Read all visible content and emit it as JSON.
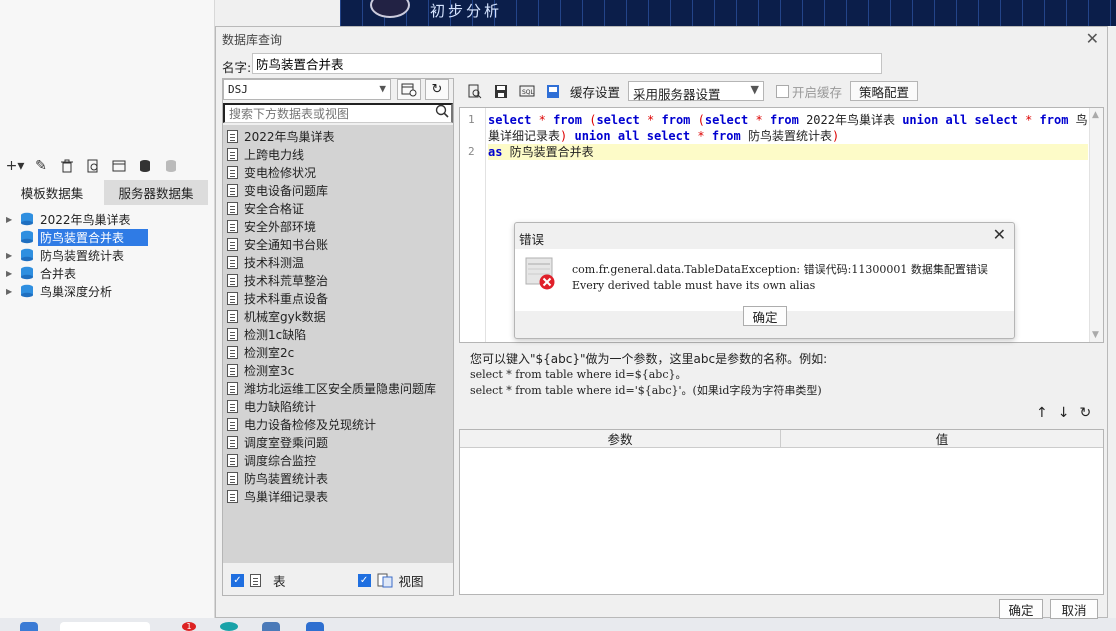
{
  "background": {
    "toolbar": {
      "add": "+▾",
      "edit": "✎",
      "delete": "🗑"
    },
    "tabs": [
      "模板数据集",
      "服务器数据集"
    ],
    "tree": [
      {
        "label": "2022年鸟巢详表",
        "selected": false
      },
      {
        "label": "防鸟装置合并表",
        "selected": true
      },
      {
        "label": "防鸟装置统计表",
        "selected": false
      },
      {
        "label": "合并表",
        "selected": false
      },
      {
        "label": "鸟巢深度分析",
        "selected": false
      }
    ],
    "top_title": "初步分析",
    "taskbar_badge": "1"
  },
  "dialog": {
    "title": "数据库查询",
    "name_label": "名字:",
    "name_value": "防鸟装置合并表",
    "connection": "DSJ",
    "search_placeholder": "搜索下方数据表或视图",
    "tables": [
      "2022年鸟巢详表",
      "上跨电力线",
      "变电检修状况",
      "变电设备问题库",
      "安全合格证",
      "安全外部环境",
      "安全通知书台账",
      "技术科测温",
      "技术科荒草整治",
      "技术科重点设备",
      "机械室gyk数据",
      "检测1c缺陷",
      "检测室2c",
      "检测室3c",
      "潍坊北运维工区安全质量隐患问题库",
      "电力缺陷统计",
      "电力设备检修及兑现统计",
      "调度室登乘问题",
      "调度综合监控",
      "防鸟装置统计表",
      "鸟巢详细记录表"
    ],
    "footer_table_label": "表",
    "footer_view_label": "视图",
    "cache_label": "缓存设置",
    "cache_value": "采用服务器设置",
    "enable_cache_label": "开启缓存",
    "strategy_label": "策略配置",
    "line_numbers": [
      "1",
      "2"
    ],
    "hint_line1": "您可以键入\"${abc}\"做为一个参数，这里abc是参数的名称。例如:",
    "hint_line2": "select * from table where id=${abc}。",
    "hint_line3": "select * from table where id='${abc}'。(如果id字段为字符串类型)",
    "param_col": "参数",
    "value_col": "值",
    "ok": "确定",
    "cancel": "取消"
  },
  "error": {
    "title": "错误",
    "message1": "com.fr.general.data.TableDataException: 错误代码:11300001 数据集配置错误",
    "message2": "Every derived table must have its own alias",
    "ok": "确定"
  },
  "colors": {
    "selected": "#2f7be5",
    "keyword": "#0000d0",
    "paren": "#dd0000",
    "error_red": "#e0202a"
  }
}
